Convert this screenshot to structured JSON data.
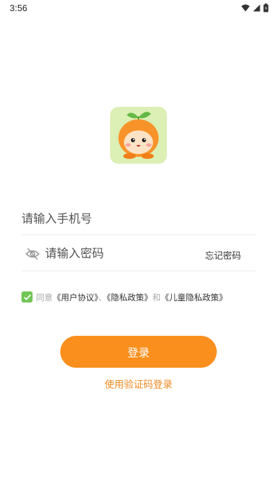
{
  "status_bar": {
    "time": "3:56",
    "icons": [
      "wifi-icon",
      "signal-icon",
      "battery-icon"
    ]
  },
  "logo": {
    "icon": "orange-mascot-logo",
    "background_color": "#dcefb4"
  },
  "login_form": {
    "phone_placeholder": "请输入手机号",
    "password_placeholder": "请输入密码",
    "password_visibility_icon": "eye-off-icon",
    "forgot_password": "忘记密码"
  },
  "agreement": {
    "checked": true,
    "prefix": "同意",
    "user_agreement": "《用户协议》",
    "separator": "、",
    "privacy_policy": "《隐私政策》",
    "conjunction": "和",
    "child_privacy_policy": "《儿童隐私政策》"
  },
  "actions": {
    "login_button": "登录",
    "sms_login": "使用验证码登录"
  },
  "colors": {
    "accent": "#fb8f1d",
    "link_orange": "#ee8a22",
    "checkbox_green": "#72c655"
  }
}
